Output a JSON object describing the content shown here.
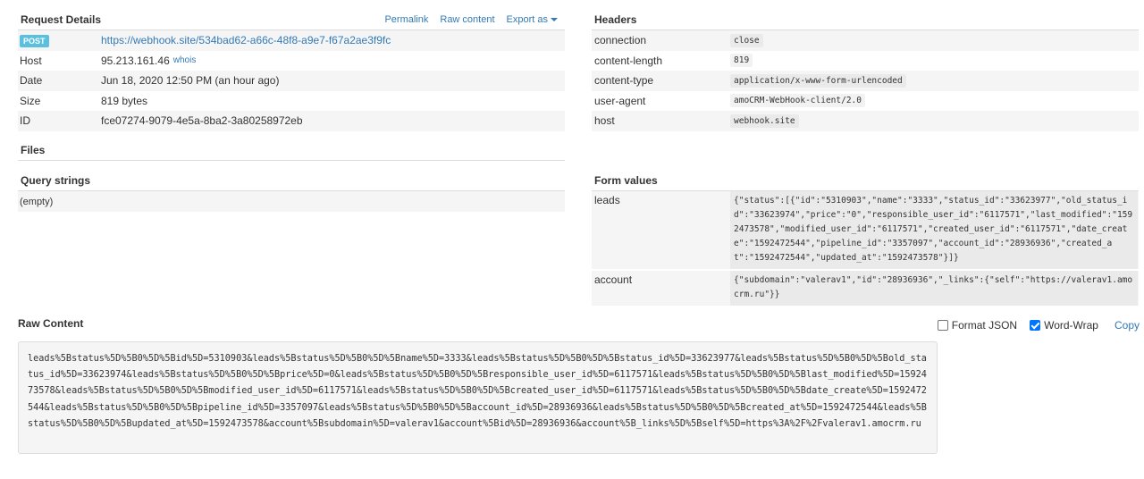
{
  "request_details": {
    "title": "Request Details",
    "links": {
      "permalink": "Permalink",
      "raw_content": "Raw content",
      "export_as": "Export as"
    },
    "method": "POST",
    "url": "https://webhook.site/534bad62-a66c-48f8-a9e7-f67a2ae3f9fc",
    "rows": [
      {
        "key": "Host",
        "value": "95.213.161.46",
        "extra": "whois"
      },
      {
        "key": "Date",
        "value": "Jun 18, 2020 12:50 PM (an hour ago)"
      },
      {
        "key": "Size",
        "value": "819 bytes"
      },
      {
        "key": "ID",
        "value": "fce07274-9079-4e5a-8ba2-3a80258972eb"
      }
    ]
  },
  "files": {
    "title": "Files"
  },
  "query_strings": {
    "title": "Query strings",
    "empty": "(empty)"
  },
  "headers": {
    "title": "Headers",
    "rows": [
      {
        "key": "connection",
        "value": "close"
      },
      {
        "key": "content-length",
        "value": "819"
      },
      {
        "key": "content-type",
        "value": "application/x-www-form-urlencoded"
      },
      {
        "key": "user-agent",
        "value": "amoCRM-WebHook-client/2.0"
      },
      {
        "key": "host",
        "value": "webhook.site"
      }
    ]
  },
  "form_values": {
    "title": "Form values",
    "rows": [
      {
        "key": "leads",
        "value": "{\"status\":[{\"id\":\"5310903\",\"name\":\"3333\",\"status_id\":\"33623977\",\"old_status_id\":\"33623974\",\"price\":\"0\",\"responsible_user_id\":\"6117571\",\"last_modified\":\"1592473578\",\"modified_user_id\":\"6117571\",\"created_user_id\":\"6117571\",\"date_create\":\"1592472544\",\"pipeline_id\":\"3357097\",\"account_id\":\"28936936\",\"created_at\":\"1592472544\",\"updated_at\":\"1592473578\"}]}"
      },
      {
        "key": "account",
        "value": "{\"subdomain\":\"valerav1\",\"id\":\"28936936\",\"_links\":{\"self\":\"https://valerav1.amocrm.ru\"}}"
      }
    ]
  },
  "raw_content": {
    "title": "Raw Content",
    "format_json_label": "Format JSON",
    "format_json_checked": false,
    "word_wrap_label": "Word-Wrap",
    "word_wrap_checked": true,
    "copy_label": "Copy",
    "body": "leads%5Bstatus%5D%5B0%5D%5Bid%5D=5310903&leads%5Bstatus%5D%5B0%5D%5Bname%5D=3333&leads%5Bstatus%5D%5B0%5D%5Bstatus_id%5D=33623977&leads%5Bstatus%5D%5B0%5D%5Bold_status_id%5D=33623974&leads%5Bstatus%5D%5B0%5D%5Bprice%5D=0&leads%5Bstatus%5D%5B0%5D%5Bresponsible_user_id%5D=6117571&leads%5Bstatus%5D%5B0%5D%5Blast_modified%5D=1592473578&leads%5Bstatus%5D%5B0%5D%5Bmodified_user_id%5D=6117571&leads%5Bstatus%5D%5B0%5D%5Bcreated_user_id%5D=6117571&leads%5Bstatus%5D%5B0%5D%5Bdate_create%5D=1592472544&leads%5Bstatus%5D%5B0%5D%5Bpipeline_id%5D=3357097&leads%5Bstatus%5D%5B0%5D%5Baccount_id%5D=28936936&leads%5Bstatus%5D%5B0%5D%5Bcreated_at%5D=1592472544&leads%5Bstatus%5D%5B0%5D%5Bupdated_at%5D=1592473578&account%5Bsubdomain%5D=valerav1&account%5Bid%5D=28936936&account%5B_links%5D%5Bself%5D=https%3A%2F%2Fvalerav1.amocrm.ru"
  },
  "colors": {
    "link": "#337ab7",
    "badge": "#5bc0de",
    "row_alt": "#f5f5f5",
    "checkbox_on": "#0075ff"
  }
}
